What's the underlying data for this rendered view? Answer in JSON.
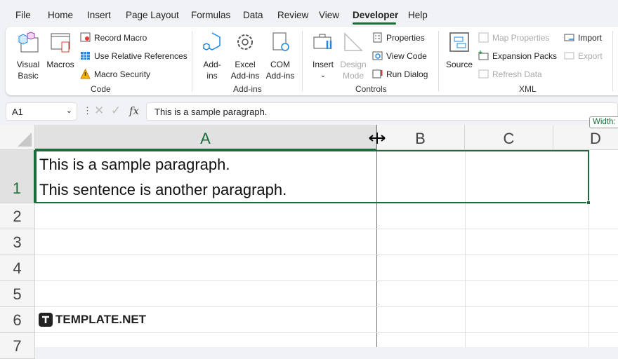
{
  "menu": [
    "File",
    "Home",
    "Insert",
    "Page Layout",
    "Formulas",
    "Data",
    "Review",
    "View",
    "Developer",
    "Help"
  ],
  "ribbon": {
    "code": {
      "visual_basic": "Visual Basic",
      "macros": "Macros",
      "record_macro": "Record Macro",
      "use_relative": "Use Relative References",
      "macro_security": "Macro Security",
      "label": "Code"
    },
    "addins": {
      "addins": "Add-ins",
      "excel_addins": "Excel Add-ins",
      "com_addins": "COM Add-ins",
      "label": "Add-ins"
    },
    "controls": {
      "insert": "Insert",
      "design_mode": "Design Mode",
      "properties": "Properties",
      "view_code": "View Code",
      "run_dialog": "Run Dialog",
      "label": "Controls"
    },
    "xml": {
      "source": "Source",
      "map_properties": "Map Properties",
      "expansion_packs": "Expansion Packs",
      "refresh_data": "Refresh Data",
      "import": "Import",
      "export": "Export",
      "label": "XML"
    }
  },
  "formula_bar": {
    "name_box": "A1",
    "fx": "fx",
    "value": "This is a sample paragraph."
  },
  "tooltip": "Width:",
  "columns": [
    "A",
    "B",
    "C",
    "D"
  ],
  "rows": [
    "1",
    "2",
    "3",
    "4",
    "5",
    "6",
    "7"
  ],
  "cells": {
    "a1_line1": "This is a sample paragraph.",
    "a1_line2": "This sentence is another paragraph."
  },
  "watermark": "TEMPLATE.NET",
  "colors": {
    "accent": "#1d6b3a"
  }
}
